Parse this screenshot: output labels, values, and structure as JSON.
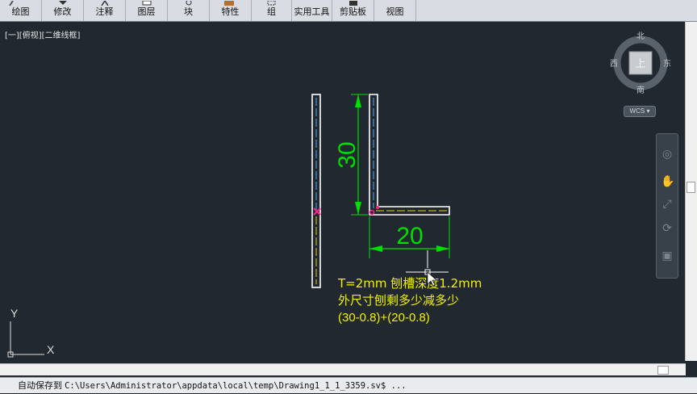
{
  "ribbon": {
    "tabs": [
      "绘图",
      "修改",
      "注释",
      "图层",
      "块",
      "特性",
      "组",
      "实用工具",
      "剪贴板",
      "视图"
    ]
  },
  "viewport": {
    "label": "[一][俯视][二维线框]"
  },
  "viewcube": {
    "north": "北",
    "south": "南",
    "east": "东",
    "west": "西",
    "top": "上",
    "wcs": "WCS"
  },
  "drawing": {
    "dim_vertical": "30",
    "dim_horizontal": "20",
    "note_line1": "T=2mm  刨槽深度1.2mm",
    "note_line2": "外尺寸刨剩多少减多少",
    "note_line3": "(30-0.8)+(20-0.8)"
  },
  "ucs": {
    "x": "X",
    "y": "Y"
  },
  "command": {
    "prefix": "自动保存到",
    "path": "C:\\Users\\Administrator\\appdata\\local\\temp\\Drawing1_1_1_3359.sv$ ..."
  },
  "colors": {
    "background": "#212830",
    "dimension": "#00e000",
    "note_text": "#f2f200",
    "outline": "#ffffff",
    "centerline_blue": "#4aa8ff",
    "centerline_yellow": "#e0d000",
    "marker": "#ff2288"
  }
}
